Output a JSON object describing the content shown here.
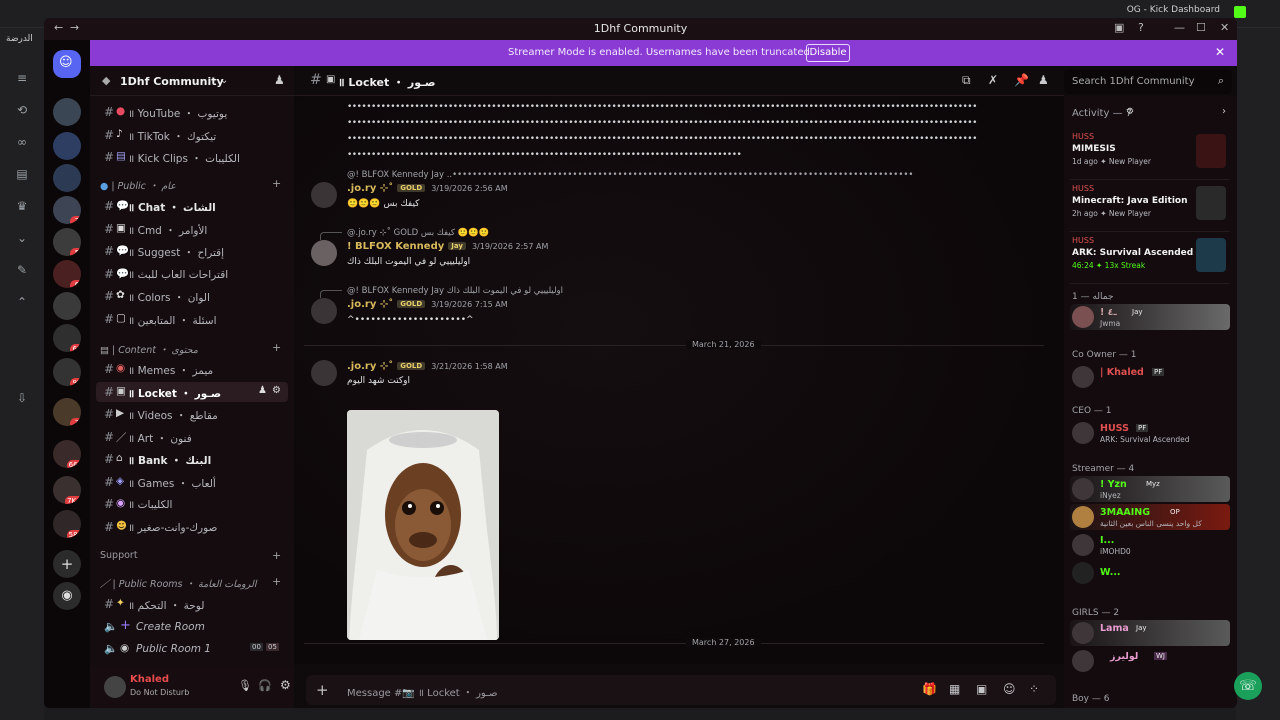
{
  "browser": {
    "tab_title": "OG - Kick Dashboard",
    "left_label": "الدرضة"
  },
  "window": {
    "title": "1Dhf Community"
  },
  "banner": {
    "message": "Streamer Mode is enabled. Usernames have been truncated.",
    "button": "Disable"
  },
  "server": {
    "name": "1Dhf Community"
  },
  "rail_badges": [
    "3",
    "5",
    "6",
    "69",
    "92",
    "3",
    "664",
    "7K+",
    "581"
  ],
  "channels": [
    {
      "label": "॥ YouTube ・ يوتيوب",
      "type": "text"
    },
    {
      "label": "॥ TikTok ・ تيكتوك",
      "type": "text"
    },
    {
      "label": "॥ Kick Clips ・ الكليبات",
      "type": "text"
    },
    {
      "label": "| Public ・ عام",
      "type": "category"
    },
    {
      "label": "॥ Chat ・ الشات",
      "type": "text"
    },
    {
      "label": "॥ Cmd ・ الأوامر",
      "type": "text"
    },
    {
      "label": "॥ Suggest ・ إقتراح",
      "type": "text"
    },
    {
      "label": "॥ اقتراحات العاب للبث",
      "type": "text"
    },
    {
      "label": "॥ Colors ・ الوان",
      "type": "text"
    },
    {
      "label": "॥ اسئلة ・ المتابعين",
      "type": "text"
    },
    {
      "label": "| Content ・ محتوى",
      "type": "category"
    },
    {
      "label": "॥ Memes ・ ميمز",
      "type": "text"
    },
    {
      "label": "॥ Locket ・ صـور",
      "type": "text",
      "active": true
    },
    {
      "label": "॥ Videos ・ مقاطع",
      "type": "text"
    },
    {
      "label": "॥ Art ・ فنون",
      "type": "text"
    },
    {
      "label": "॥ Bank ・ البنك",
      "type": "text"
    },
    {
      "label": "॥ Games ・ ألعاب",
      "type": "text"
    },
    {
      "label": "॥ الكليبات",
      "type": "text"
    },
    {
      "label": "॥ صورك-وانت-صغير",
      "type": "text"
    },
    {
      "label": "Support",
      "type": "category"
    },
    {
      "label": "| Public Rooms ・ الرومات العامة",
      "type": "category"
    },
    {
      "label": "॥ لوحة ・ التحكم",
      "type": "text"
    },
    {
      "label": "Create Room",
      "type": "voice"
    },
    {
      "label": "Public Room 1",
      "type": "voice"
    }
  ],
  "voice_counts": [
    "00",
    "05"
  ],
  "user": {
    "name": "Khaled",
    "status": "Do Not Disturb"
  },
  "channel": {
    "name": "॥ Locket ・ صـور",
    "search_placeholder": "Search 1Dhf Community"
  },
  "chat": {
    "junk_lines": [
      "•••••••••••••••••••••••••••••••••••••••••••••••••••••••••••••••••••••••••••••••••••••••••••••••••••••••••••••••••••••••••••••••••••",
      "•••••••••••••••••••••••••••••••••••••••••••••••••••••••••••••••••••••••••••••••••••••••••••••••••••••••••••••••••••••••••••••••••••",
      "•••••••••••••••••••••••••••••••••••••••••••••••••••••••••••••••••••••••••••••••••••••••••••••••••••••••••••••••••••••••••••••••••••",
      "••••••••••••••••••••••••••••••••••••••••••••••••••••••••••••••••••••••••••••••••••"
    ],
    "messages": [
      {
        "reply": "@! BLFOX Kennedy  Jay  ..••••••••••••••••••••••••••••••••••••••••••••••••••••••••••••••••••••••••••••••••••••••••••••",
        "user": ".jo.ry ⊹˚",
        "tag": "GOLD",
        "time": "3/19/2026 2:56 AM",
        "text": "🙂🙂🙂 كيفك بس"
      },
      {
        "reply": "@.jo.ry ⊹˚  GOLD  كيفك بس 🙂🙂🙂",
        "user": "! BLFOX Kennedy",
        "tag": "Jay",
        "time": "3/19/2026 2:57 AM",
        "text": "اوليليييي لو في اليموت البلك ذاك"
      },
      {
        "reply": "@! BLFOX Kennedy  Jay  اوليليييي لو في اليموت البلك ذاك",
        "user": ".jo.ry ⊹˚",
        "tag": "GOLD",
        "time": "3/19/2026 7:15 AM",
        "text": "^•••••••••••••••••••••^"
      },
      {
        "user": ".jo.ry ⊹˚",
        "tag": "GOLD",
        "time": "3/21/2026 1:58 AM",
        "text": "اوكتت شهد اليوم"
      }
    ],
    "dates": [
      "March 21, 2026",
      "March 27, 2026"
    ],
    "composer_placeholder": "Message #📷 ॥ Locket ・ صـور"
  },
  "members": {
    "activity_header": "Activity — 7",
    "activities": [
      {
        "user": "HUSS",
        "title": "MIMESIS",
        "sub": "1d ago  ✦ New Player"
      },
      {
        "user": "HUSS",
        "title": "Minecraft: Java Edition",
        "sub": "2h ago  ✦ New Player"
      },
      {
        "user": "HUSS",
        "title": "ARK: Survival Ascended",
        "sub": "46:24  ✦ 13x Streak"
      }
    ],
    "groups": [
      {
        "label": "جماله — 1",
        "members": [
          {
            "name": "! ـ٤",
            "tag": "Jay",
            "sub": "Jwma",
            "color": "#c9a0a0"
          }
        ]
      },
      {
        "label": "Co Owner — 1",
        "members": [
          {
            "name": "| Khaled",
            "tag": "PF",
            "sub": "",
            "color": "#e05050"
          }
        ]
      },
      {
        "label": "CEO — 1",
        "members": [
          {
            "name": "HUSS",
            "tag": "PF",
            "sub": "ARK: Survival Ascended",
            "color": "#e05050"
          }
        ]
      },
      {
        "label": "Streamer — 4",
        "members": [
          {
            "name": "! Yzn",
            "tag": "Myz",
            "sub": "iNyez",
            "color": "#53fc18"
          },
          {
            "name": "3MAAING",
            "tag": "OP",
            "sub": "كل واحد ينسى الناس بعين الثانية",
            "color": "#53fc18"
          },
          {
            "name": "I...",
            "tag": "",
            "sub": "iMOHD0",
            "color": "#53fc18"
          },
          {
            "name": "W...",
            "tag": "",
            "sub": "",
            "color": "#53fc18"
          }
        ]
      },
      {
        "label": "GIRLS — 2",
        "members": [
          {
            "name": "Lama",
            "tag": "Jay",
            "sub": "",
            "color": "#e79bd0"
          },
          {
            "name": "لوليرز",
            "tag": "WJ",
            "sub": "",
            "color": "#e79bd0"
          }
        ]
      },
      {
        "label": "Boy — 6",
        "members": []
      }
    ]
  },
  "colors": {
    "banner": "#8a3bd4",
    "gold": "#d8b95c",
    "kick_green": "#53fc18",
    "danger": "#e23d40"
  }
}
